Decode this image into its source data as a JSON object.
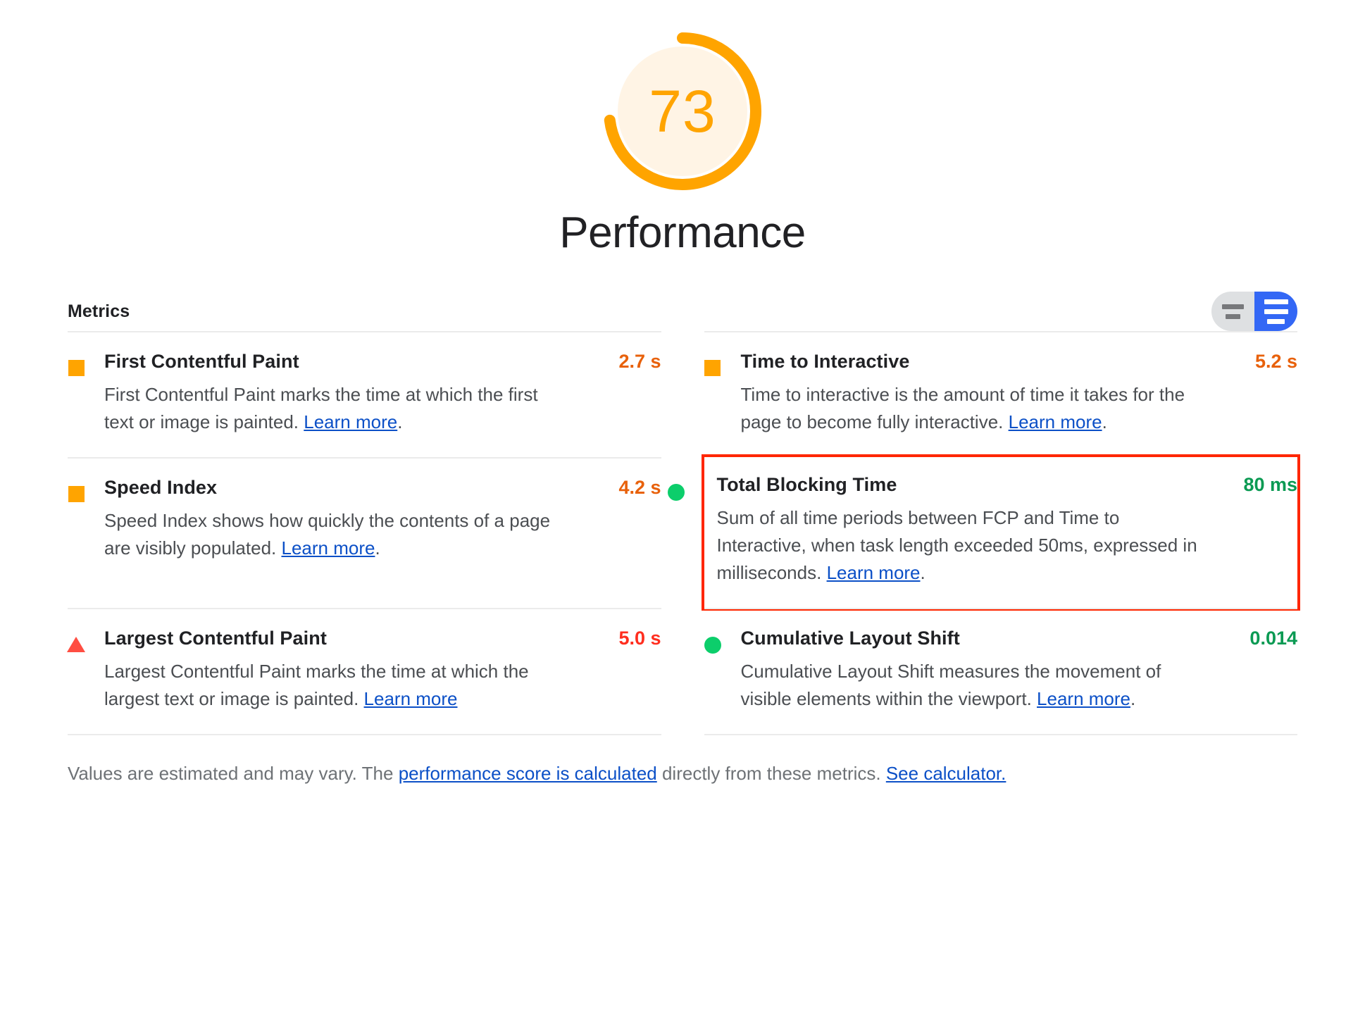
{
  "gauge": {
    "score": "73",
    "score_value": 73,
    "category_title": "Performance",
    "ring_color": "#FFA400",
    "fill_color": "#FFF4E5"
  },
  "metrics_section": {
    "heading": "Metrics",
    "toggle": {
      "name": "metric-description-toggle",
      "left_option": "simple-view",
      "right_option": "expanded-view",
      "selected": "expanded-view",
      "active_color": "#3367F5",
      "inactive_color": "#DEE0E2"
    },
    "items": [
      {
        "name": "First Contentful Paint",
        "value": "2.7 s",
        "rating": "average",
        "icon": "square-icon",
        "description_before": "First Contentful Paint marks the time at which the first text or image is painted. ",
        "link_text": "Learn more",
        "description_after": "."
      },
      {
        "name": "Time to Interactive",
        "value": "5.2 s",
        "rating": "average",
        "icon": "square-icon",
        "description_before": "Time to interactive is the amount of time it takes for the page to become fully interactive. ",
        "link_text": "Learn more",
        "description_after": "."
      },
      {
        "name": "Speed Index",
        "value": "4.2 s",
        "rating": "average",
        "icon": "square-icon",
        "description_before": "Speed Index shows how quickly the contents of a page are visibly populated. ",
        "link_text": "Learn more",
        "description_after": "."
      },
      {
        "name": "Total Blocking Time",
        "value": "80 ms",
        "rating": "pass",
        "icon": "circle-icon",
        "highlighted": true,
        "description_before": "Sum of all time periods between FCP and Time to Interactive, when task length exceeded 50ms, expressed in milliseconds. ",
        "link_text": "Learn more",
        "description_after": "."
      },
      {
        "name": "Largest Contentful Paint",
        "value": "5.0 s",
        "rating": "fail",
        "icon": "triangle-icon",
        "description_before": "Largest Contentful Paint marks the time at which the largest text or image is painted. ",
        "link_text": "Learn more",
        "description_after": ""
      },
      {
        "name": "Cumulative Layout Shift",
        "value": "0.014",
        "rating": "pass",
        "icon": "circle-icon",
        "description_before": "Cumulative Layout Shift measures the movement of visible elements within the viewport. ",
        "link_text": "Learn more",
        "description_after": "."
      }
    ]
  },
  "footer": {
    "text_1": "Values are estimated and may vary. The ",
    "link_1": "performance score is calculated",
    "text_2": " directly from these metrics. ",
    "link_2": "See calculator."
  },
  "colors": {
    "pass": "#0CCE6B",
    "average": "#FFA400",
    "fail": "#FF4E42",
    "link": "#0c50c7",
    "highlight_box": "#FF2600"
  }
}
